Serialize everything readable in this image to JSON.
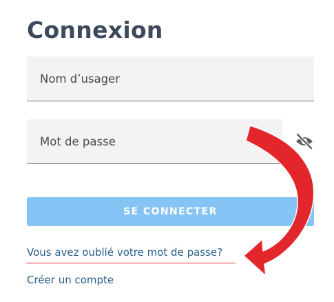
{
  "login": {
    "title": "Connexion",
    "username_placeholder": "Nom d’usager",
    "password_placeholder": "Mot de passe",
    "password_visibility_icon": "eye-slash-icon",
    "submit_label": "SE CONNECTER",
    "forgot_password_label": "Vous avez oublié votre mot de passe?",
    "create_account_label": "Créer un compte"
  },
  "annotation": {
    "arrow_color": "#e3262b",
    "arrow_icon": "curved-arrow-icon"
  },
  "colors": {
    "title": "#3d4a5c",
    "field_background": "#f3f3f3",
    "button_background": "#85c4f5",
    "link": "#2a5d8a"
  }
}
